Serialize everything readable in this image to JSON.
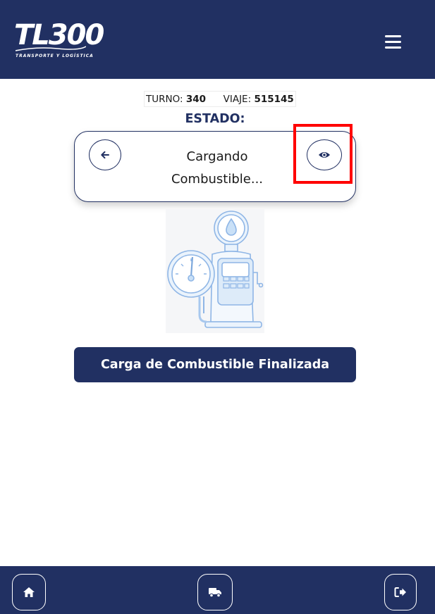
{
  "header": {
    "logo_text": "TL300",
    "logo_tagline": "TRANSPORTE Y LOGÍSTICA",
    "menu_icon": "hamburger-menu-icon",
    "background_color": "#213062"
  },
  "trip_info": {
    "turno_label": "TURNO:",
    "turno_value": "340",
    "viaje_label": "VIAJE:",
    "viaje_value": "515145"
  },
  "estado": {
    "title": "ESTADO:",
    "status_line1": "Cargando",
    "status_line2": "Combustible...",
    "back_icon": "arrow-left-icon",
    "view_icon": "eye-icon",
    "highlight_color": "#ff0000"
  },
  "illustration": {
    "icon": "fuel-pump-illustration"
  },
  "actions": {
    "primary_label": "Carga de Combustible Finalizada"
  },
  "footer": {
    "items": [
      {
        "icon": "home-icon"
      },
      {
        "icon": "truck-icon"
      },
      {
        "icon": "logout-icon"
      }
    ]
  }
}
